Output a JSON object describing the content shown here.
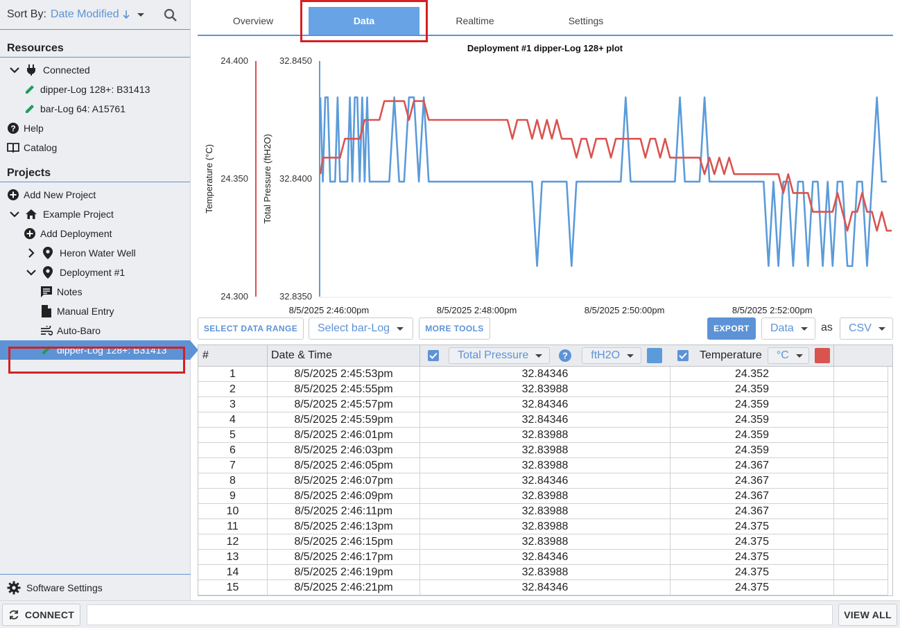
{
  "sidebar": {
    "sort_label": "Sort By:",
    "sort_value": "Date Modified",
    "resources_title": "Resources",
    "resources": [
      {
        "label": "Connected"
      },
      {
        "label": "dipper-Log 128+: B31413"
      },
      {
        "label": "bar-Log 64: A15761"
      }
    ],
    "help": "Help",
    "catalog": "Catalog",
    "projects_title": "Projects",
    "add_new_project": "Add New Project",
    "example_project": "Example Project",
    "add_deployment": "Add Deployment",
    "heron_water_well": "Heron Water Well",
    "deployment_1": "Deployment #1",
    "notes": "Notes",
    "manual_entry": "Manual Entry",
    "auto_baro": "Auto-Baro",
    "selected_logger": "dipper-Log 128+: B31413",
    "software_settings": "Software Settings"
  },
  "bottom": {
    "connect": "CONNECT",
    "view_all": "VIEW ALL"
  },
  "tabs": [
    "Overview",
    "Data",
    "Realtime",
    "Settings"
  ],
  "toolbar": {
    "select_data_range": "SELECT DATA RANGE",
    "select_barlog": "Select bar-Log",
    "more_tools": "MORE TOOLS",
    "export": "EXPORT",
    "export_what": "Data",
    "as": "as",
    "format": "CSV"
  },
  "table": {
    "col_num": "#",
    "col_datetime": "Date & Time",
    "col_pressure": "Total Pressure",
    "pressure_unit": "ftH2O",
    "col_temperature": "Temperature",
    "temperature_unit": "°C",
    "rows": [
      [
        "1",
        "8/5/2025 2:45:53pm",
        "32.84346",
        "24.352"
      ],
      [
        "2",
        "8/5/2025 2:45:55pm",
        "32.83988",
        "24.359"
      ],
      [
        "3",
        "8/5/2025 2:45:57pm",
        "32.84346",
        "24.359"
      ],
      [
        "4",
        "8/5/2025 2:45:59pm",
        "32.84346",
        "24.359"
      ],
      [
        "5",
        "8/5/2025 2:46:01pm",
        "32.83988",
        "24.359"
      ],
      [
        "6",
        "8/5/2025 2:46:03pm",
        "32.83988",
        "24.359"
      ],
      [
        "7",
        "8/5/2025 2:46:05pm",
        "32.83988",
        "24.367"
      ],
      [
        "8",
        "8/5/2025 2:46:07pm",
        "32.84346",
        "24.367"
      ],
      [
        "9",
        "8/5/2025 2:46:09pm",
        "32.83988",
        "24.367"
      ],
      [
        "10",
        "8/5/2025 2:46:11pm",
        "32.83988",
        "24.367"
      ],
      [
        "11",
        "8/5/2025 2:46:13pm",
        "32.83988",
        "24.375"
      ],
      [
        "12",
        "8/5/2025 2:46:15pm",
        "32.83988",
        "24.375"
      ],
      [
        "13",
        "8/5/2025 2:46:17pm",
        "32.84346",
        "24.375"
      ],
      [
        "14",
        "8/5/2025 2:46:19pm",
        "32.83988",
        "24.375"
      ],
      [
        "15",
        "8/5/2025 2:46:21pm",
        "32.84346",
        "24.375"
      ]
    ]
  },
  "colors": {
    "accent": "#5d93d6",
    "pressure": "#5b9bd9",
    "temperature": "#d9534f",
    "highlight": "#d42020"
  },
  "chart_data": {
    "type": "line",
    "title": "Deployment #1 dipper-Log 128+ plot",
    "xlabel": "",
    "x_ticks": [
      "8/5/2025 2:46:00pm",
      "8/5/2025 2:48:00pm",
      "8/5/2025 2:50:00pm",
      "8/5/2025 2:52:00pm"
    ],
    "axes": [
      {
        "label": "Temperature (°C)",
        "ticks": [
          "24.400",
          "24.350",
          "24.300"
        ],
        "range": [
          24.3,
          24.4
        ]
      },
      {
        "label": "Total Pressure (ftH2O)",
        "ticks": [
          "32.8450",
          "32.8400",
          "32.8350"
        ],
        "range": [
          32.835,
          32.845
        ]
      }
    ],
    "x_range_seconds": [
      0,
      464
    ],
    "series": [
      {
        "name": "Total Pressure",
        "axis": "Total Pressure (ftH2O)",
        "t": [
          0,
          2,
          4,
          6,
          8,
          10,
          12,
          14,
          16,
          18,
          20,
          22,
          24,
          26,
          28,
          30,
          32,
          34,
          36,
          38,
          40,
          44,
          48,
          52,
          56,
          60,
          64,
          68,
          72,
          76,
          80,
          84,
          88,
          92,
          96,
          100,
          104,
          108,
          112,
          116,
          120,
          124,
          128,
          132,
          136,
          140,
          144,
          148,
          152,
          156,
          160,
          164,
          168,
          172,
          176,
          180,
          184,
          188,
          192,
          196,
          200,
          204,
          208,
          212,
          216,
          220,
          224,
          228,
          232,
          236,
          240,
          244,
          248,
          252,
          256,
          260,
          264,
          268,
          272,
          276,
          280,
          284,
          288,
          292,
          296,
          300,
          304,
          308,
          312,
          316,
          320,
          324,
          328,
          332,
          336,
          340,
          344,
          348,
          352,
          356,
          360,
          364,
          368,
          372,
          376,
          380,
          384,
          388,
          392,
          396,
          400,
          404,
          408,
          412,
          416,
          420,
          424,
          428,
          432,
          436,
          440,
          444,
          448,
          452,
          456,
          460,
          464
        ],
        "values": [
          32.84346,
          32.83988,
          32.84346,
          32.84346,
          32.83988,
          32.83988,
          32.83988,
          32.84346,
          32.83988,
          32.83988,
          32.83988,
          32.83988,
          32.84346,
          32.83988,
          32.84346,
          32.84346,
          32.83988,
          32.84346,
          32.83988,
          32.84346,
          32.83988,
          32.83988,
          32.83988,
          32.83988,
          32.83988,
          32.84346,
          32.83988,
          32.83988,
          32.84346,
          32.84346,
          32.83988,
          32.84346,
          32.83988,
          32.83988,
          32.83988,
          32.83988,
          32.83988,
          32.83988,
          32.83988,
          32.83988,
          32.83988,
          32.83988,
          32.83988,
          32.83988,
          32.83988,
          32.83988,
          32.83988,
          32.83988,
          32.83988,
          32.83988,
          32.83988,
          32.83988,
          32.83988,
          32.83988,
          32.8363,
          32.83988,
          32.83988,
          32.83988,
          32.83988,
          32.83988,
          32.83988,
          32.8363,
          32.83988,
          32.83988,
          32.83988,
          32.83988,
          32.83988,
          32.83988,
          32.83988,
          32.83988,
          32.83988,
          32.83988,
          32.84346,
          32.83988,
          32.83988,
          32.83988,
          32.83988,
          32.83988,
          32.83988,
          32.83988,
          32.83988,
          32.83988,
          32.83988,
          32.84346,
          32.83988,
          32.83988,
          32.83988,
          32.83988,
          32.84346,
          32.83988,
          32.83988,
          32.83988,
          32.83988,
          32.83988,
          32.83988,
          32.83988,
          32.83988,
          32.83988,
          32.83988,
          32.83988,
          32.83988,
          32.8363,
          32.83988,
          32.8363,
          32.83988,
          32.83988,
          32.8363,
          32.83988,
          32.83988,
          32.8363,
          32.83988,
          32.83988,
          32.8363,
          32.83988,
          32.8363,
          32.83988,
          32.83988,
          32.8363,
          32.8363,
          32.83988,
          32.83988,
          32.8363,
          32.83988,
          32.84346,
          32.83988,
          32.83988
        ],
        "color": "#5b9bd9"
      },
      {
        "name": "Temperature",
        "axis": "Temperature (°C)",
        "t": [
          0,
          2,
          4,
          8,
          12,
          16,
          20,
          24,
          28,
          32,
          36,
          40,
          44,
          48,
          52,
          56,
          60,
          64,
          68,
          72,
          76,
          80,
          84,
          88,
          92,
          96,
          100,
          104,
          108,
          112,
          116,
          120,
          124,
          128,
          132,
          136,
          140,
          144,
          148,
          152,
          156,
          160,
          164,
          168,
          172,
          176,
          180,
          184,
          188,
          192,
          196,
          200,
          204,
          208,
          212,
          216,
          220,
          224,
          228,
          232,
          236,
          240,
          244,
          248,
          252,
          256,
          260,
          264,
          268,
          272,
          276,
          280,
          284,
          288,
          292,
          296,
          300,
          304,
          308,
          312,
          316,
          320,
          324,
          328,
          332,
          336,
          340,
          344,
          348,
          352,
          356,
          360,
          364,
          368,
          372,
          376,
          380,
          384,
          388,
          392,
          396,
          400,
          404,
          408,
          412,
          416,
          420,
          424,
          428,
          432,
          436,
          440,
          444,
          448,
          452,
          456,
          460,
          464
        ],
        "values": [
          24.352,
          24.359,
          24.359,
          24.359,
          24.359,
          24.359,
          24.367,
          24.367,
          24.367,
          24.367,
          24.375,
          24.375,
          24.375,
          24.375,
          24.383,
          24.383,
          24.383,
          24.383,
          24.383,
          24.375,
          24.383,
          24.383,
          24.383,
          24.375,
          24.375,
          24.375,
          24.375,
          24.375,
          24.375,
          24.375,
          24.375,
          24.375,
          24.375,
          24.375,
          24.375,
          24.375,
          24.375,
          24.375,
          24.375,
          24.375,
          24.367,
          24.375,
          24.375,
          24.375,
          24.367,
          24.375,
          24.367,
          24.375,
          24.367,
          24.375,
          24.367,
          24.367,
          24.367,
          24.359,
          24.367,
          24.367,
          24.359,
          24.367,
          24.367,
          24.367,
          24.359,
          24.367,
          24.367,
          24.367,
          24.367,
          24.367,
          24.367,
          24.359,
          24.367,
          24.367,
          24.359,
          24.367,
          24.359,
          24.359,
          24.359,
          24.359,
          24.359,
          24.359,
          24.359,
          24.352,
          24.359,
          24.352,
          24.359,
          24.352,
          24.359,
          24.352,
          24.352,
          24.352,
          24.352,
          24.352,
          24.352,
          24.352,
          24.352,
          24.352,
          24.352,
          24.344,
          24.352,
          24.344,
          24.344,
          24.344,
          24.344,
          24.336,
          24.336,
          24.336,
          24.336,
          24.336,
          24.344,
          24.336,
          24.328,
          24.336,
          24.336,
          24.344,
          24.336,
          24.336,
          24.328,
          24.336,
          24.328,
          24.328,
          24.328,
          24.328,
          24.328,
          24.32,
          24.328
        ],
        "color": "#d9534f"
      }
    ],
    "grid": false,
    "legend": "none"
  }
}
